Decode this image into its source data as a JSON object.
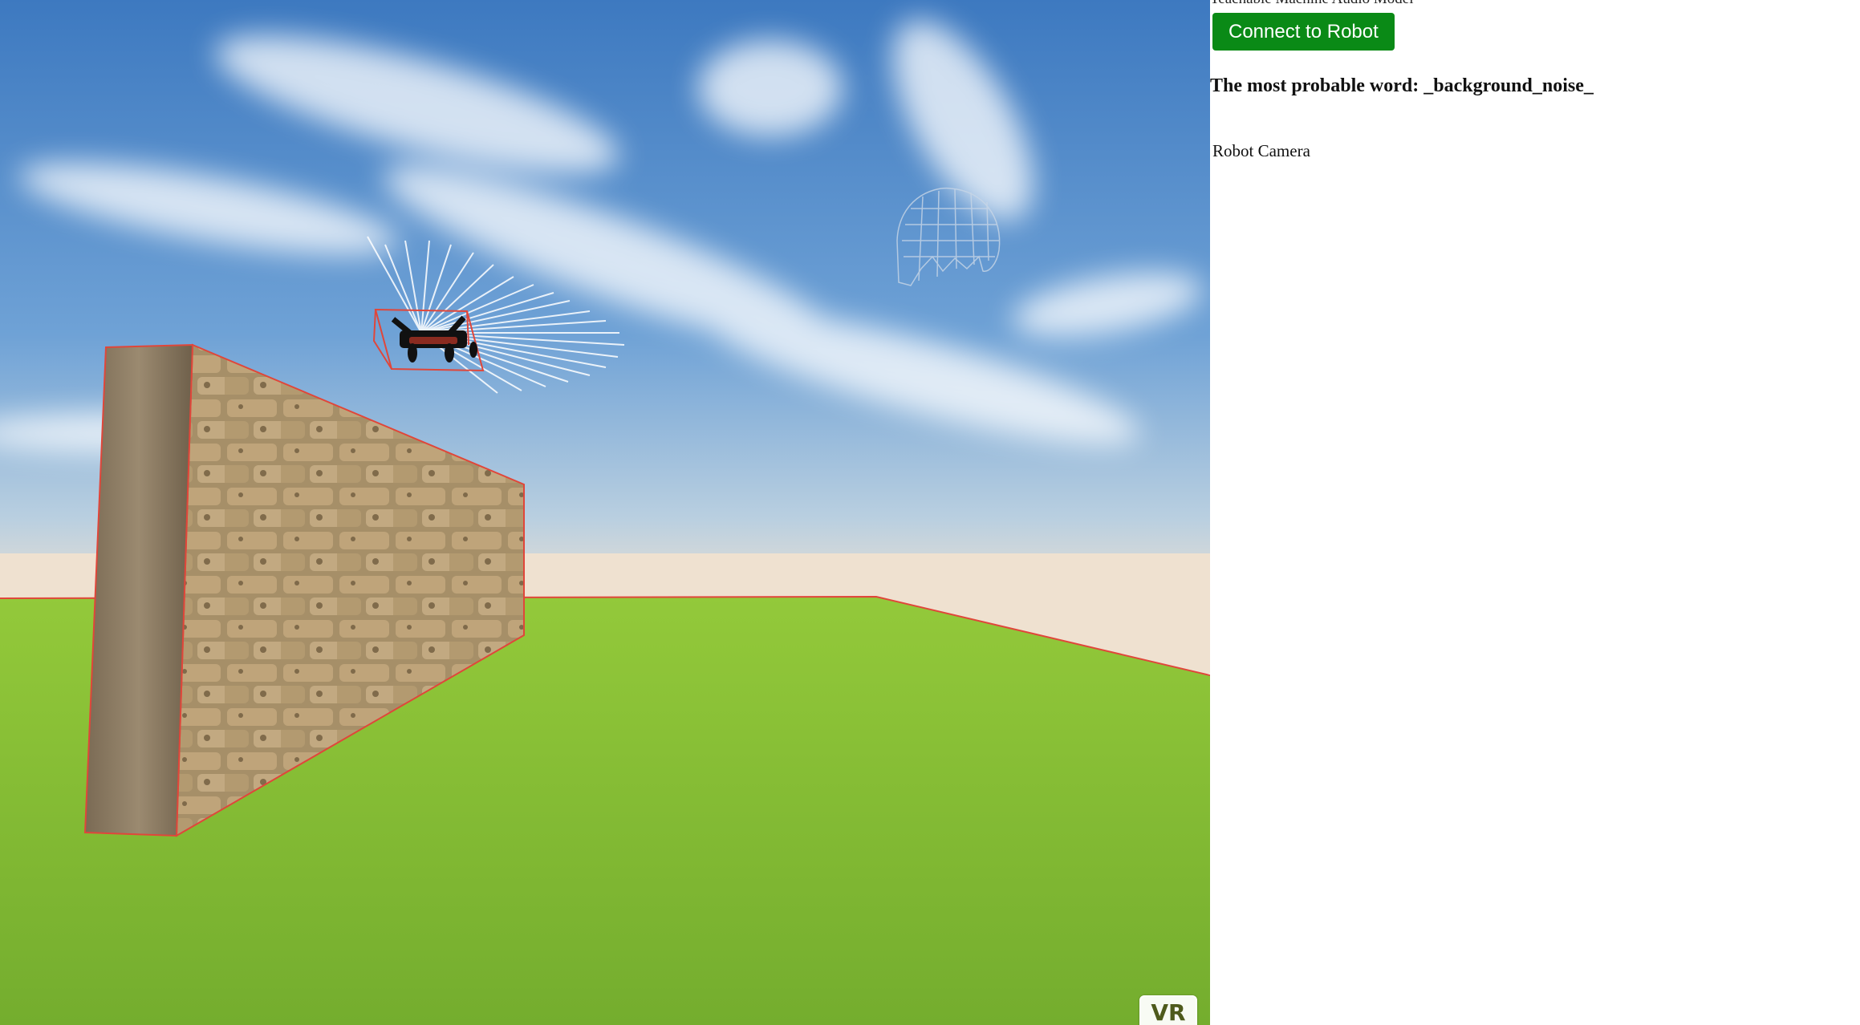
{
  "panel": {
    "model_title": "Teachable Machine Audio Model",
    "connect_label": "Connect to Robot",
    "word_prefix": "The most probable word:",
    "word_value": "_background_noise_",
    "camera_label": "Robot Camera"
  },
  "scene": {
    "vr_label": "VR",
    "sky_color": "#4a86c8",
    "ground_color": "#8cc43a",
    "wall_color": "#9a8660",
    "outline_color": "#e0463a"
  }
}
